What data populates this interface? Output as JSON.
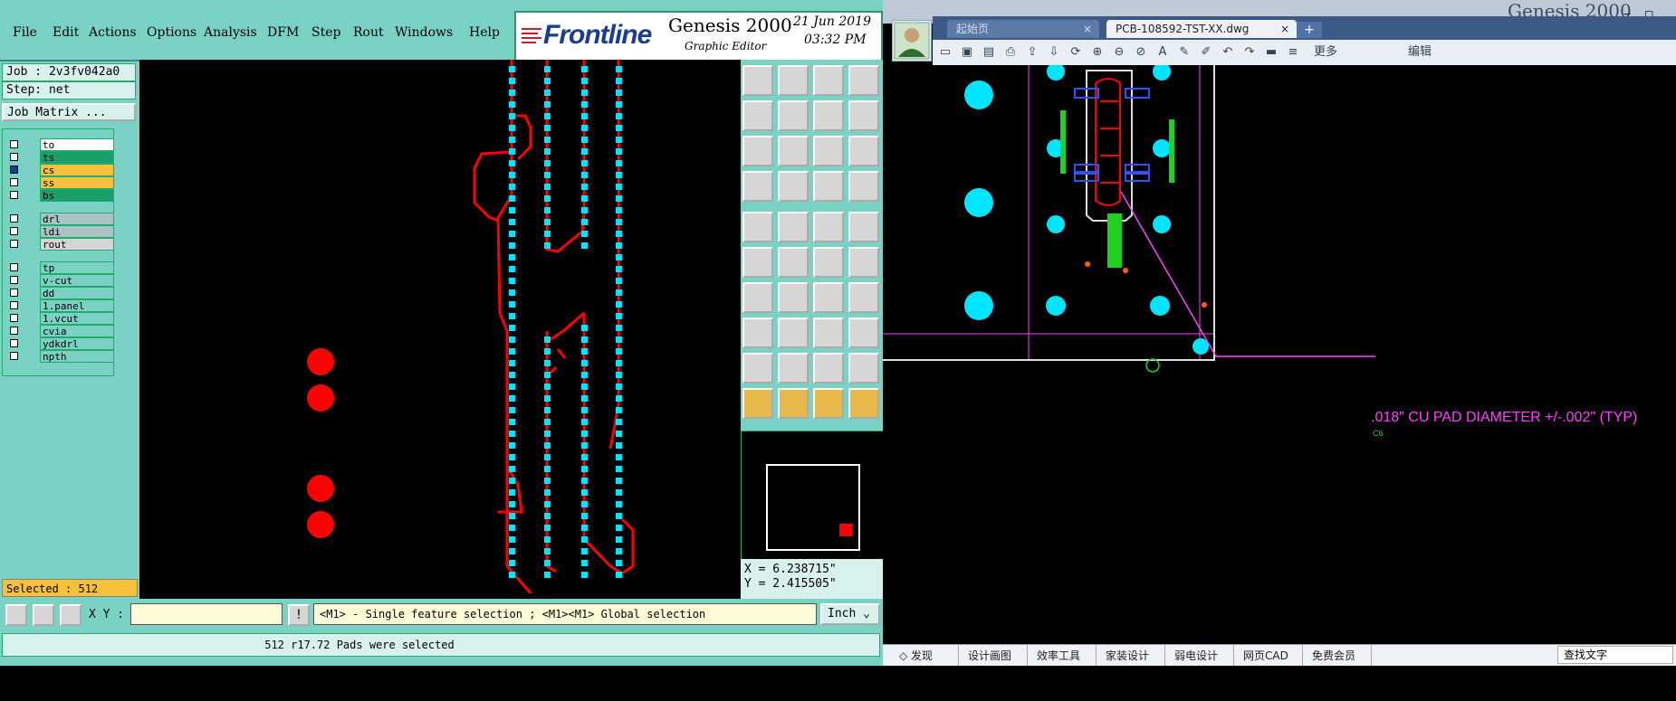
{
  "genesis": {
    "menus": [
      "File",
      "Edit",
      "Actions",
      "Options",
      "Analysis",
      "DFM",
      "Step",
      "Rout",
      "Windows",
      "Help"
    ],
    "brand": "Frontline",
    "product": "Genesis 2000",
    "subtitle": "Graphic Editor",
    "date": "21 Jun 2019",
    "time": "03:32 PM",
    "job_label": "Job : 2v3fv042a0",
    "step_label": "Step: net",
    "job_matrix": "Job Matrix ...",
    "layers": [
      {
        "name": "to",
        "color": "#ffffff"
      },
      {
        "name": "ts",
        "color": "#1a9e6a"
      },
      {
        "name": "cs",
        "color": "#f6c03a"
      },
      {
        "name": "ss",
        "color": "#f6c03a"
      },
      {
        "name": "bs",
        "color": "#1a9e6a"
      },
      {
        "name": "drl",
        "color": "#a9c2c6"
      },
      {
        "name": "ldi",
        "color": "#a9c2c6"
      },
      {
        "name": "rout",
        "color": "#d6d6d6"
      },
      {
        "name": "tp",
        "color": "#79d2c4"
      },
      {
        "name": "v-cut",
        "color": "#79d2c4"
      },
      {
        "name": "dd",
        "color": "#79d2c4"
      },
      {
        "name": "1.panel",
        "color": "#79d2c4"
      },
      {
        "name": "1.vcut",
        "color": "#79d2c4"
      },
      {
        "name": "cvia",
        "color": "#79d2c4"
      },
      {
        "name": "ydkdrl",
        "color": "#79d2c4"
      },
      {
        "name": "npth",
        "color": "#79d2c4"
      }
    ],
    "selected": "Selected : 512",
    "xy_label": "X Y :",
    "xy_value": "",
    "hint": "<M1> - Single feature selection ; <M1><M1> Global selection",
    "unit": "Inch",
    "status": "512 r17.72 Pads were selected",
    "coord_x": "X = 6.238715\"",
    "coord_y": "Y = 2.415505\""
  },
  "cad": {
    "tabs": [
      "起始页",
      "PCB-108592-TST-XX.dwg"
    ],
    "more_label": "更多",
    "edit_label": "编辑",
    "note": ".018\" CU PAD DIAMETER +/-.002\" (TYP)",
    "note_tag": "C6",
    "bottom_tabs": [
      "发现",
      "设计画图",
      "效率工具",
      "家装设计",
      "弱电设计",
      "网页CAD",
      "免费会员"
    ],
    "find_label": "查找文字",
    "bg_title": "Genesis 2000"
  },
  "colors": {
    "panel": "#79d2c4",
    "trace": "#ff0000",
    "pad": "#00e5ff",
    "magenta": "#ff40ff"
  }
}
